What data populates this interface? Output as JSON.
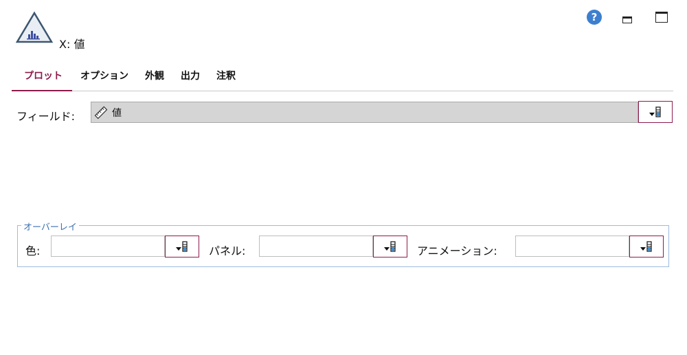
{
  "header": {
    "title": "X: 値"
  },
  "tabs": [
    {
      "label": "プロット",
      "active": true
    },
    {
      "label": "オプション",
      "active": false
    },
    {
      "label": "外観",
      "active": false
    },
    {
      "label": "出力",
      "active": false
    },
    {
      "label": "注釈",
      "active": false
    }
  ],
  "field": {
    "label": "フィールド:",
    "value": "値"
  },
  "overlay": {
    "legend": "オーバーレイ",
    "color_label": "色:",
    "color_value": "",
    "panel_label": "パネル:",
    "panel_value": "",
    "animation_label": "アニメーション:",
    "animation_value": ""
  },
  "icons": {
    "app": "histogram-triangle-icon",
    "help": "help-icon",
    "minimize": "minimize-icon",
    "maximize": "maximize-icon",
    "field_type": "ruler-icon",
    "picker": "variable-picker-icon"
  },
  "colors": {
    "accent": "#8c1a4a",
    "help_blue": "#3d7fcf",
    "overlay_border": "#9bbbe0",
    "field_bg": "#d5d5d5"
  }
}
